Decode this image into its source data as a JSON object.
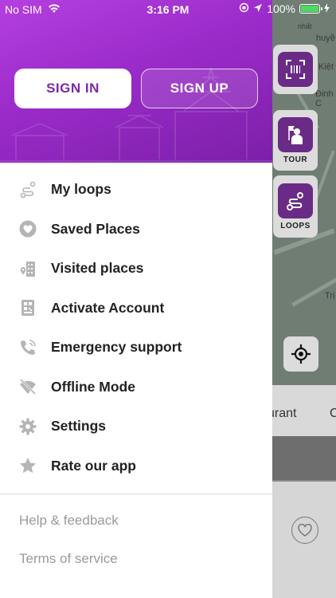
{
  "status_bar": {
    "carrier": "No SIM",
    "time": "3:16 PM",
    "battery": "100%"
  },
  "auth": {
    "sign_in": "SIGN IN",
    "sign_up": "SIGN UP"
  },
  "menu": {
    "items": [
      {
        "label": "My loops",
        "icon": "loop-route-icon"
      },
      {
        "label": "Saved Places",
        "icon": "heart-icon"
      },
      {
        "label": "Visited places",
        "icon": "visited-building-icon"
      },
      {
        "label": "Activate Account",
        "icon": "qr-code-icon"
      },
      {
        "label": "Emergency support",
        "icon": "phone-call-icon"
      },
      {
        "label": "Offline Mode",
        "icon": "wifi-off-icon"
      },
      {
        "label": "Settings",
        "icon": "gear-icon"
      },
      {
        "label": "Rate our app",
        "icon": "star-icon"
      }
    ]
  },
  "footer": {
    "help": "Help & feedback",
    "terms": "Terms of service"
  },
  "background": {
    "tour_label": "TOUR",
    "loops_label": "LOOPS",
    "tab_partial_1": "urant",
    "tab_partial_2": "C",
    "map_text_1": "huyề",
    "map_text_2": "Kiệt",
    "map_text_3": "Đinh C",
    "map_text_4": "nhất",
    "map_text_5": "Trị"
  },
  "colors": {
    "brand_purple": "#9a2bc9",
    "icon_gray": "#b5b5b5",
    "text_dark": "#222222",
    "text_muted": "#9a9a9a"
  }
}
